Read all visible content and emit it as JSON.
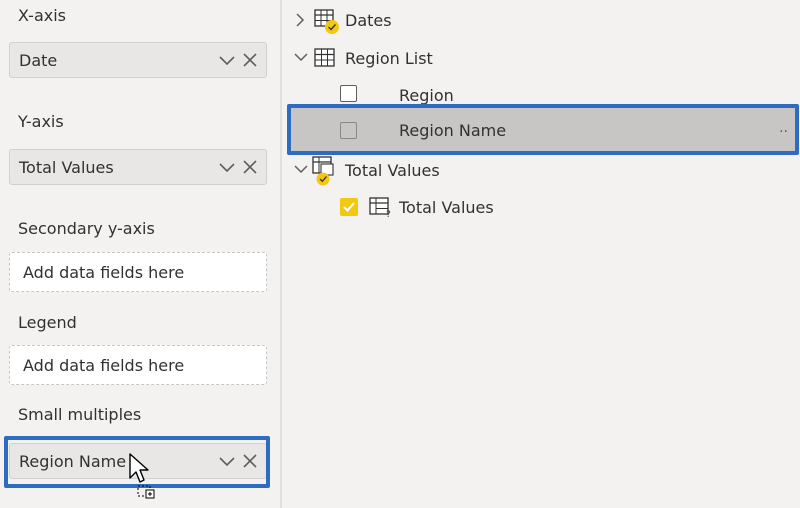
{
  "left_pane": {
    "x_axis": {
      "label": "X-axis",
      "value": "Date"
    },
    "y_axis": {
      "label": "Y-axis",
      "value": "Total Values"
    },
    "secondary_y_axis": {
      "label": "Secondary y-axis",
      "placeholder": "Add data fields here"
    },
    "legend": {
      "label": "Legend",
      "placeholder": "Add data fields here"
    },
    "small_multiples": {
      "label": "Small multiples",
      "value": "Region Name"
    }
  },
  "fields_pane": {
    "tables": [
      {
        "name": "Dates",
        "expanded": false,
        "icon": "table-check-icon"
      },
      {
        "name": "Region List",
        "expanded": true,
        "icon": "table-icon",
        "fields": [
          {
            "name": "Region",
            "checked": false
          },
          {
            "name": "Region Name",
            "checked": false,
            "selected": true,
            "more": ".."
          }
        ]
      },
      {
        "name": "Total Values",
        "expanded": true,
        "icon": "measure-table-icon",
        "fields": [
          {
            "name": "Total Values",
            "checked": true,
            "icon": "measure-icon"
          }
        ]
      }
    ]
  },
  "colors": {
    "highlight": "#2d6cc0",
    "check_yellow": "#f2c811",
    "selected_row": "#c8c6c4"
  }
}
